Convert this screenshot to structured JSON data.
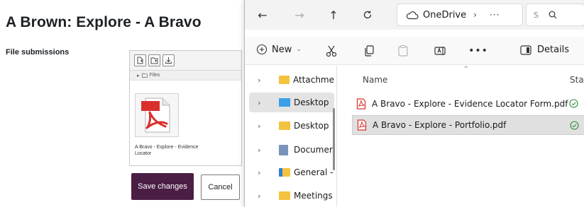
{
  "moodle": {
    "page_title": "A Brown: Explore - A Bravo",
    "file_submissions_label": "File submissions",
    "filepicker": {
      "path_label": "Files",
      "file_name": "A Bravo - Explore - Evidence Locator"
    },
    "save_label": "Save changes",
    "cancel_label": "Cancel"
  },
  "explorer": {
    "address": "OneDrive",
    "address_more": "···",
    "search_placeholder": "S",
    "toolbar": {
      "new_label": "New",
      "details_label": "Details"
    },
    "nav_items": [
      {
        "label": "Attachme",
        "icon": "folder-yellow",
        "selected": false
      },
      {
        "label": "Desktop",
        "icon": "folder-blue",
        "selected": true
      },
      {
        "label": "Desktop",
        "icon": "folder-yellow",
        "selected": false
      },
      {
        "label": "Documer",
        "icon": "documents",
        "selected": false
      },
      {
        "label": "General -",
        "icon": "shared-folder",
        "selected": false
      },
      {
        "label": "Meetings",
        "icon": "folder-yellow",
        "selected": false
      }
    ],
    "columns": {
      "name": "Name",
      "status": "Stat"
    },
    "files": [
      {
        "name": "A Bravo - Explore - Evidence Locator Form.pdf",
        "status": "synced",
        "selected": false
      },
      {
        "name": "A Bravo - Explore - Portfolio.pdf",
        "status": "synced",
        "selected": true
      }
    ],
    "colors": {
      "save_button": "#4b1e46",
      "pdf_red": "#d9302c",
      "status_green": "#2f8f3a",
      "folder_yellow": "#f4c23e",
      "folder_blue": "#3aa0e8"
    }
  }
}
